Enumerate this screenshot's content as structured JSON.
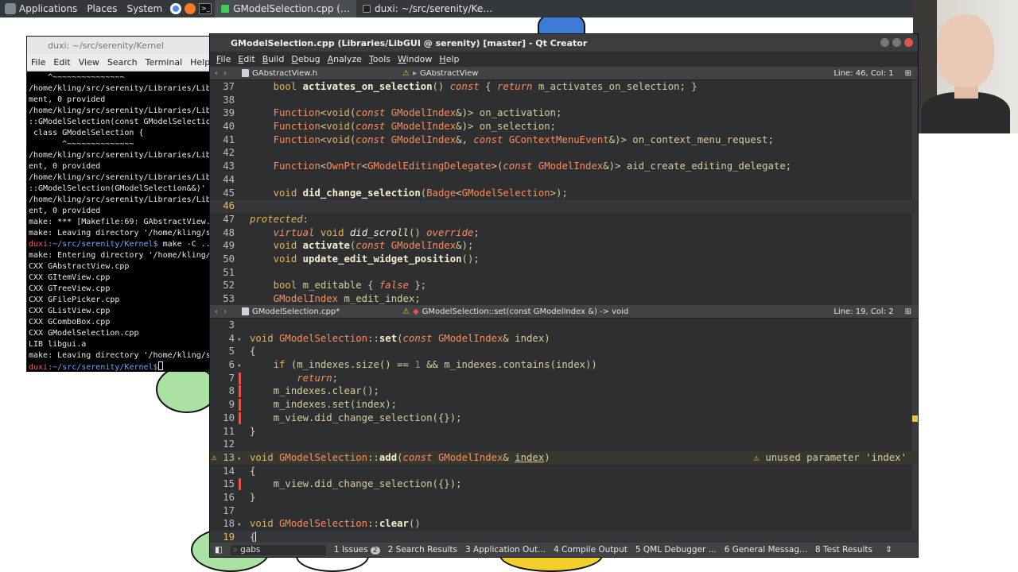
{
  "top_panel": {
    "applications": "Applications",
    "places": "Places",
    "system": "System",
    "tasks": [
      {
        "label": "GModelSelection.cpp (…",
        "active": true
      },
      {
        "label": "duxi: ~/src/serenity/Ke…",
        "active": false
      }
    ]
  },
  "terminal": {
    "title": "duxi: ~/src/serenity/Kernel",
    "menu": [
      "File",
      "Edit",
      "View",
      "Search",
      "Terminal",
      "Help"
    ],
    "lines": [
      "    ^~~~~~~~~~~~~~~~",
      "/home/kling/src/serenity/Libraries/Lib",
      "ment, 0 provided",
      "/home/kling/src/serenity/Libraries/Lib",
      "::GModelSelection(const GModelSelectio",
      " class GModelSelection {",
      "       ^~~~~~~~~~~~~~~",
      "/home/kling/src/serenity/Libraries/Lib",
      "ent, 0 provided",
      "/home/kling/src/serenity/Libraries/Lib",
      "::GModelSelection(GModelSelection&&)'",
      "/home/kling/src/serenity/Libraries/Lib",
      "ent, 0 provided",
      "make: *** [Makefile:69: GAbstractView.",
      "make: Leaving directory '/home/kling/s"
    ],
    "prompt_user": "duxi",
    "prompt_path": ":~/src/serenity/Kernel$",
    "prompt_cmd1": " make -C ..",
    "lines2": [
      "make: Entering directory '/home/kling/",
      "CXX GAbstractView.cpp",
      "CXX GItemView.cpp",
      "CXX GTreeView.cpp",
      "CXX GFilePicker.cpp",
      "CXX GListView.cpp",
      "CXX GComboBox.cpp",
      "CXX GModelSelection.cpp",
      "LIB libgui.a",
      "make: Leaving directory '/home/kling/s"
    ]
  },
  "qtcreator": {
    "title": "GModelSelection.cpp (Libraries/LibGUI @ serenity) [master] - Qt Creator",
    "menu": [
      "File",
      "Edit",
      "Build",
      "Debug",
      "Analyze",
      "Tools",
      "Window",
      "Help"
    ],
    "top_editor": {
      "file": "GAbstractView.h",
      "symbol": "GAbstractView",
      "position": "Line: 46, Col: 1"
    },
    "bottom_editor": {
      "file": "GModelSelection.cpp*",
      "symbol": "GModelSelection::set(const GModelIndex &) -> void",
      "position": "Line: 19, Col: 2",
      "warning": "unused parameter 'index'"
    },
    "output_tabs": [
      {
        "label": "1 Issues",
        "badge": "2"
      },
      {
        "label": "2 Search Results"
      },
      {
        "label": "3 Application Out..."
      },
      {
        "label": "4 Compile Output"
      },
      {
        "label": "5 QML Debugger ..."
      },
      {
        "label": "6 General Messag..."
      },
      {
        "label": "8 Test Results"
      }
    ],
    "filter": "gabs"
  }
}
